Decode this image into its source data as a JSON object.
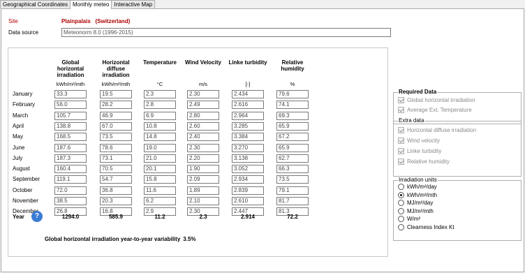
{
  "tabs": [
    "Geographical Coordinates",
    "Monthly meteo",
    "Interactive Map"
  ],
  "site": {
    "label": "Site",
    "value": "Plainpalais   (Switzerland)"
  },
  "data_source": {
    "label": "Data source",
    "value": "Meteonorm 8.0 (1996-2015)"
  },
  "columns": [
    {
      "title": "Global\nhorizontal\nirradiation",
      "unit": "kWh/m²/mth"
    },
    {
      "title": "Horizontal\ndiffuse\nirradiation",
      "unit": "kWh/m²/mth"
    },
    {
      "title": "Temperature",
      "unit": "°C"
    },
    {
      "title": "Wind Velocity",
      "unit": "m/s"
    },
    {
      "title": "Linke turbidity",
      "unit": "[-]"
    },
    {
      "title": "Relative\nhumidity",
      "unit": "%"
    }
  ],
  "months": [
    "January",
    "February",
    "March",
    "April",
    "May",
    "June",
    "July",
    "August",
    "September",
    "October",
    "November",
    "December"
  ],
  "rows": [
    [
      "33.3",
      "19.5",
      "2.3",
      "2.30",
      "2.434",
      "79.6"
    ],
    [
      "56.0",
      "28.2",
      "2.8",
      "2.49",
      "2.616",
      "74.1"
    ],
    [
      "105.7",
      "46.9",
      "6.9",
      "2.80",
      "2.964",
      "69.3"
    ],
    [
      "138.8",
      "67.0",
      "10.8",
      "2.60",
      "3.285",
      "65.9"
    ],
    [
      "168.5",
      "73.5",
      "14.8",
      "2.40",
      "3.384",
      "67.2"
    ],
    [
      "187.6",
      "78.6",
      "19.0",
      "2.30",
      "3.270",
      "65.9"
    ],
    [
      "187.3",
      "73.1",
      "21.0",
      "2.20",
      "3.138",
      "62.7"
    ],
    [
      "160.4",
      "70.5",
      "20.1",
      "1.90",
      "3.052",
      "66.3"
    ],
    [
      "119.1",
      "54.7",
      "15.8",
      "2.09",
      "2.934",
      "73.5"
    ],
    [
      "72.0",
      "36.8",
      "11.6",
      "1.89",
      "2.839",
      "79.1"
    ],
    [
      "38.5",
      "20.3",
      "6.2",
      "2.10",
      "2.610",
      "81.7"
    ],
    [
      "26.8",
      "16.8",
      "2.9",
      "2.30",
      "2.447",
      "81.3"
    ]
  ],
  "year": {
    "label": "Year",
    "values": [
      "1294.0",
      "585.9",
      "11.2",
      "2.3",
      "2.914",
      "72.2"
    ]
  },
  "variability": {
    "label": "Global horizontal irradiation year-to-year variability",
    "value": "3.5%"
  },
  "required": {
    "title": "Required Data",
    "items": [
      "Global horizontal irradiation",
      "Average Ext. Temperature"
    ]
  },
  "extra": {
    "title": "Extra data",
    "items": [
      "Horizontal diffuse irradiation",
      "Wind velocity",
      "Linke turbidity",
      "Relative humidity"
    ]
  },
  "units": {
    "title": "Irradiation units",
    "options": [
      "kWh/m²/day",
      "kWh/m²/mth",
      "MJ/m²/day",
      "MJ/m²/mth",
      "W/m²",
      "Clearness Index Kt"
    ],
    "selected": 1
  }
}
